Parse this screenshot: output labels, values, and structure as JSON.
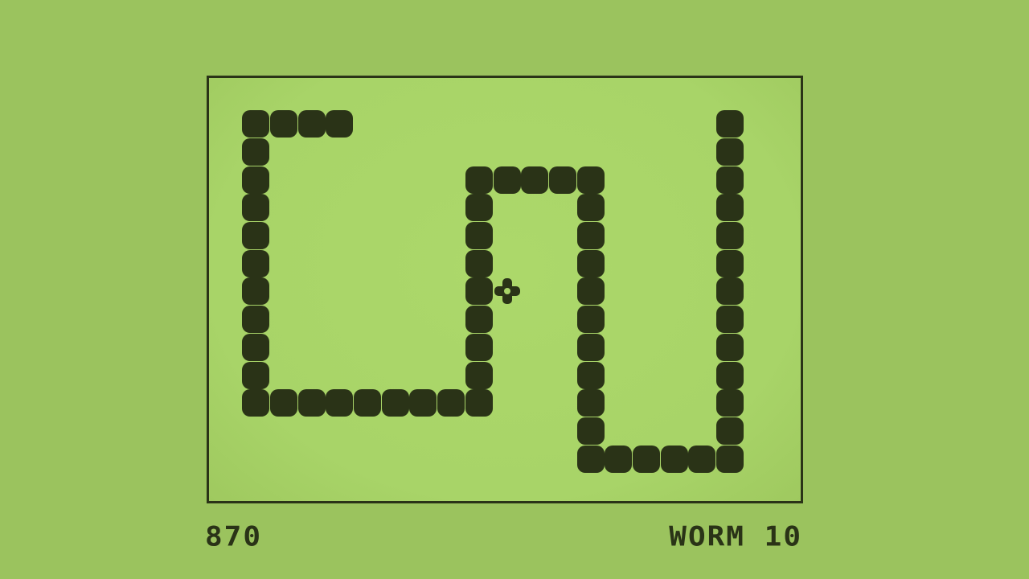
{
  "hud": {
    "score": "870",
    "level_label": "WORM 10"
  },
  "colors": {
    "background": "#9bc35e",
    "board": "#a8d468",
    "ink": "#2a3317"
  },
  "food": {
    "icon": "food-pellet-icon",
    "col": 10,
    "row": 7
  },
  "snake": {
    "segments": [
      [
        4,
        1
      ],
      [
        3,
        1
      ],
      [
        2,
        1
      ],
      [
        1,
        1
      ],
      [
        1,
        2
      ],
      [
        1,
        3
      ],
      [
        1,
        4
      ],
      [
        1,
        5
      ],
      [
        1,
        6
      ],
      [
        1,
        7
      ],
      [
        1,
        8
      ],
      [
        1,
        9
      ],
      [
        1,
        10
      ],
      [
        1,
        11
      ],
      [
        2,
        11
      ],
      [
        3,
        11
      ],
      [
        4,
        11
      ],
      [
        5,
        11
      ],
      [
        6,
        11
      ],
      [
        7,
        11
      ],
      [
        8,
        11
      ],
      [
        9,
        11
      ],
      [
        9,
        10
      ],
      [
        9,
        9
      ],
      [
        9,
        8
      ],
      [
        9,
        7
      ],
      [
        9,
        6
      ],
      [
        9,
        5
      ],
      [
        9,
        4
      ],
      [
        9,
        3
      ],
      [
        10,
        3
      ],
      [
        11,
        3
      ],
      [
        12,
        3
      ],
      [
        13,
        3
      ],
      [
        13,
        4
      ],
      [
        13,
        5
      ],
      [
        13,
        6
      ],
      [
        13,
        7
      ],
      [
        13,
        8
      ],
      [
        13,
        9
      ],
      [
        13,
        10
      ],
      [
        13,
        11
      ],
      [
        13,
        12
      ],
      [
        13,
        13
      ],
      [
        14,
        13
      ],
      [
        15,
        13
      ],
      [
        16,
        13
      ],
      [
        17,
        13
      ],
      [
        18,
        13
      ],
      [
        18,
        12
      ],
      [
        18,
        11
      ],
      [
        18,
        10
      ],
      [
        18,
        9
      ],
      [
        18,
        8
      ],
      [
        18,
        7
      ],
      [
        18,
        6
      ],
      [
        18,
        5
      ],
      [
        18,
        4
      ],
      [
        18,
        3
      ],
      [
        18,
        2
      ],
      [
        18,
        1
      ]
    ]
  }
}
